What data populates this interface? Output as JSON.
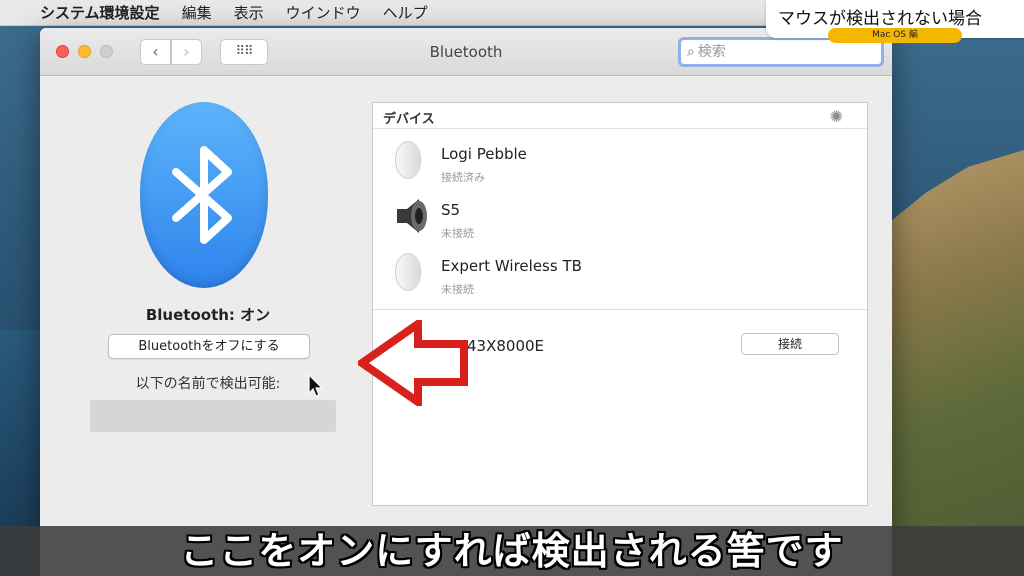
{
  "menubar": {
    "apple_icon": "apple-logo-icon",
    "app_name": "システム環境設定",
    "items": [
      "編集",
      "表示",
      "ウインドウ",
      "ヘルプ"
    ]
  },
  "caption": {
    "title": "マウスが検出されない場合",
    "badge": "Mac OS 編",
    "badge_color": "#f3b700"
  },
  "window": {
    "title": "Bluetooth",
    "search_placeholder": "検索",
    "nav_back": "‹",
    "nav_forward": "›",
    "grid_icon": "⠿⠿"
  },
  "bluetooth": {
    "status": "Bluetooth: オン",
    "toggle_button": "Bluetoothをオフにする",
    "discoverable_label": "以下の名前で検出可能:",
    "logo_color": "#2e84ec"
  },
  "devices": {
    "header": "デバイス",
    "list": [
      {
        "name": "Logi Pebble",
        "status": "接続済み",
        "icon": "mouse-icon"
      },
      {
        "name": "S5",
        "status": "未接続",
        "icon": "speaker-icon"
      },
      {
        "name": "Expert Wireless TB",
        "status": "未接続",
        "icon": "mouse-icon"
      }
    ],
    "other_device": "43X8000E",
    "connect_button": "接続"
  },
  "overlay": {
    "arrow_color": "#d8201c",
    "subtitle": "ここをオンにすれば検出される筈です"
  }
}
